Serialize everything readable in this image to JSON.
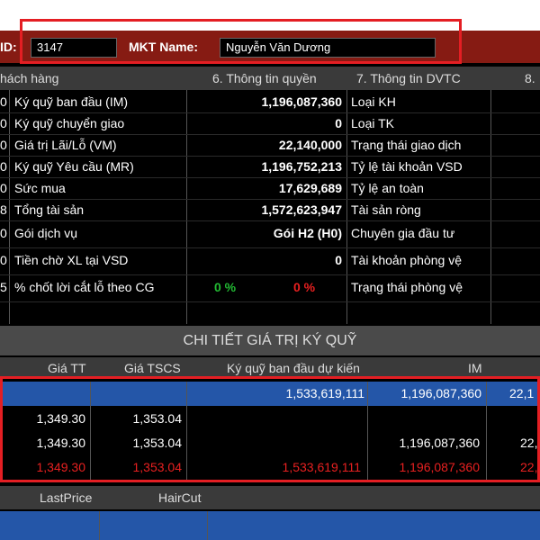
{
  "header": {
    "id_label": "ID:",
    "id_value": "3147",
    "mkt_label": "MKT Name:",
    "mkt_value": "Nguyễn Văn Dương"
  },
  "tabs": {
    "t1": "hách hàng",
    "t6": "6. Thông tin quyền",
    "t7": "7. Thông tin DVTC",
    "t8": "8."
  },
  "rows": [
    {
      "prefix": "0",
      "label": "Ký quỹ ban đầu (IM)",
      "value": "1,196,087,360",
      "right": "Loại KH"
    },
    {
      "prefix": "0",
      "label": "Ký quỹ chuyển giao",
      "value": "0",
      "right": "Loại TK"
    },
    {
      "prefix": "0",
      "label": "Giá trị Lãi/Lỗ (VM)",
      "value": "22,140,000",
      "right": "Trạng thái giao dịch"
    },
    {
      "prefix": "0",
      "label": "Ký quỹ Yêu cầu (MR)",
      "value": "1,196,752,213",
      "right": "Tỷ lệ tài khoản VSD"
    },
    {
      "prefix": "0",
      "label": "Sức mua",
      "value": "17,629,689",
      "right": "Tỷ lệ an toàn"
    },
    {
      "prefix": "8",
      "label": "Tổng tài sản",
      "value": "1,572,623,947",
      "right": "Tài sản ròng"
    },
    {
      "prefix": "0",
      "label": "Gói dịch vụ",
      "value": "Gói H2 (H0)",
      "right": "Chuyên gia đầu tư"
    },
    {
      "prefix": "0",
      "label": "Tiền chờ XL tại VSD",
      "value": "0",
      "right": "Tài khoản phòng vệ"
    },
    {
      "prefix": "5",
      "label": "% chốt lời cắt lỗ theo CG",
      "value_green": "0 %",
      "value_red": "0 %",
      "right": "Trạng thái phòng vệ"
    }
  ],
  "section": {
    "title": "CHI TIẾT GIÁ TRỊ KÝ QUỸ",
    "cols": [
      "Giá TT",
      "Giá TSCS",
      "Ký quỹ ban đầu dự kiến",
      "IM"
    ]
  },
  "detail": [
    {
      "gia_tt": "",
      "gia_tscs": "",
      "kq": "1,533,619,111",
      "im": "1,196,087,360",
      "extra": "22,1"
    },
    {
      "gia_tt": "1,349.30",
      "gia_tscs": "1,353.04",
      "kq": "",
      "im": "",
      "extra": ""
    },
    {
      "gia_tt": "1,349.30",
      "gia_tscs": "1,353.04",
      "kq": "",
      "im": "1,196,087,360",
      "extra": "22,"
    },
    {
      "gia_tt": "1,349.30",
      "gia_tscs": "1,353.04",
      "kq": "1,533,619,111",
      "im": "1,196,087,360",
      "extra": "22,"
    }
  ],
  "bottom": {
    "col1": "LastPrice",
    "col2": "HairCut"
  },
  "colors": {
    "accent_bar": "#861b13",
    "highlight_row": "#2456a8",
    "red_text": "#e82020",
    "green_text": "#22bb33",
    "red_outline": "#e41e23"
  }
}
